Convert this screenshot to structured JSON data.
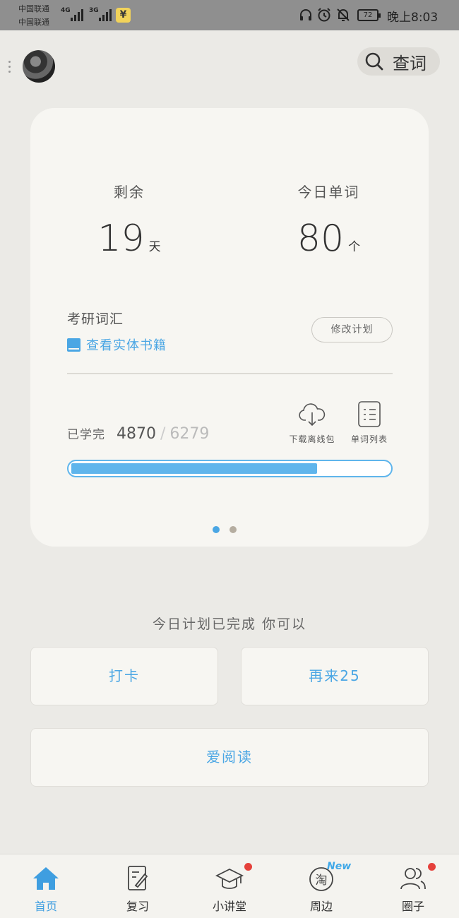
{
  "status_bar": {
    "carrier_1": "中国联通",
    "carrier_2": "中国联通",
    "network_1": "4G",
    "network_2": "3G",
    "payment_badge": "¥",
    "battery": "72",
    "time": "晚上8:03"
  },
  "header": {
    "search_label": "查词"
  },
  "plan_card": {
    "remaining_label": "剩余",
    "remaining_days": "19",
    "remaining_unit": "天",
    "today_label": "今日单词",
    "today_words": "80",
    "today_unit": "个",
    "book_name": "考研词汇",
    "book_link": "查看实体书籍",
    "modify_button": "修改计划",
    "learned_label": "已学完",
    "learned_count": "4870",
    "separator": "/",
    "total_count": "6279",
    "download_label": "下载离线包",
    "word_list_label": "单词列表",
    "progress": 0.7756,
    "page_count": 2,
    "active_page": 1
  },
  "completion": {
    "message": "今日计划已完成 你可以",
    "checkin_button": "打卡",
    "again_button": "再来25",
    "read_button": "爱阅读"
  },
  "bottom_nav": {
    "items": [
      {
        "label": "首页",
        "icon": "home-icon",
        "active": true
      },
      {
        "label": "复习",
        "icon": "review-icon",
        "active": false
      },
      {
        "label": "小讲堂",
        "icon": "graduation-cap-icon",
        "badge": true
      },
      {
        "label": "周边",
        "icon": "taobao-icon",
        "tag": "New"
      },
      {
        "label": "圈子",
        "icon": "people-icon",
        "badge": true
      }
    ]
  },
  "colors": {
    "accent": "#4aa6e4",
    "background": "#ebeae6",
    "card": "#f7f6f2",
    "badge_red": "#e5413b"
  }
}
